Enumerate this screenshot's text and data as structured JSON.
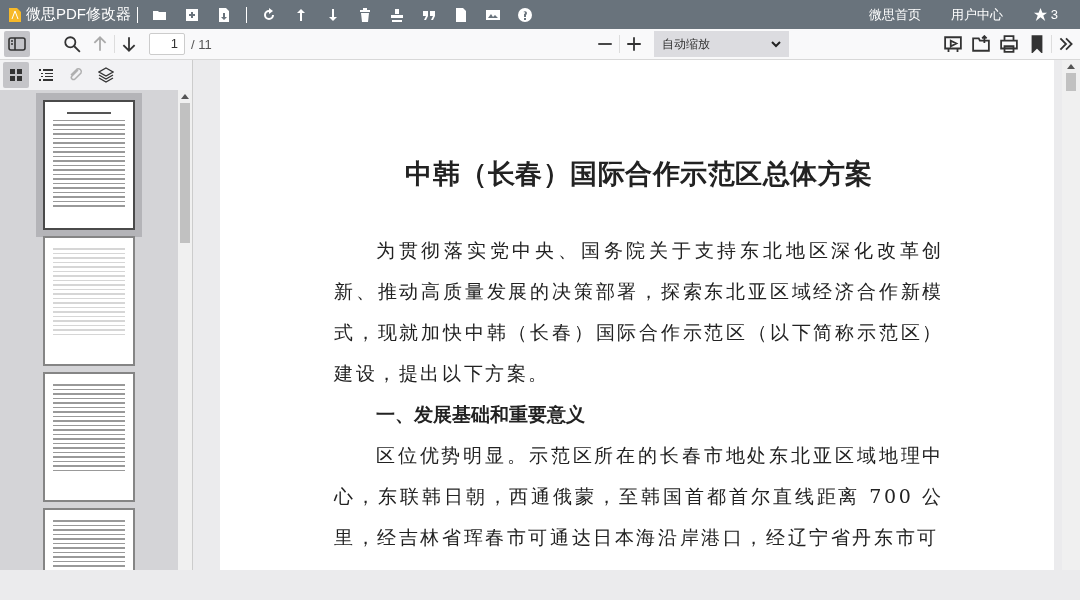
{
  "app": {
    "title": "微思PDF修改器",
    "links": [
      {
        "label": "微思首页"
      },
      {
        "label": "用户中心"
      }
    ],
    "star_count": "3"
  },
  "toolbar": {
    "sidebar_open": true,
    "nav_buttons": [
      {
        "kind": "previous",
        "disabled": true
      },
      {
        "kind": "next",
        "disabled": false
      }
    ],
    "page_input": "1",
    "page_count": "/ 11",
    "zoom": "自动缩放"
  },
  "sidebar": {
    "tabs": [
      {
        "kind": "thumbnails",
        "selected": true,
        "disabled": false
      },
      {
        "kind": "outline",
        "selected": false,
        "disabled": false
      },
      {
        "kind": "attachments",
        "selected": false,
        "disabled": true
      },
      {
        "kind": "layers",
        "selected": false,
        "disabled": false
      }
    ],
    "thumbnails": [
      {
        "selected": true,
        "kind": "title"
      },
      {
        "selected": false,
        "kind": "faint"
      },
      {
        "selected": false,
        "kind": "dense"
      },
      {
        "selected": false,
        "kind": "dense"
      }
    ]
  },
  "document": {
    "title": "中韩（长春）国际合作示范区总体方案",
    "blocks": [
      {
        "kind": "paragraph",
        "text": "为贯彻落实党中央、国务院关于支持东北地区深化改革创新、推动高质量发展的决策部署，探索东北亚区域经济合作新模式，现就加快中韩（长春）国际合作示范区（以下简称示范区）建设，提出以下方案。"
      },
      {
        "kind": "heading",
        "text": "一、发展基础和重要意义"
      },
      {
        "kind": "paragraph",
        "text": "区位优势明显。示范区所在的长春市地处东北亚区域地理中心，东联韩日朝，西通俄蒙，至韩国首都首尔直线距离 700 公里，经吉林省珲春市可通达日本海沿岸港口，经辽宁省丹东市可"
      }
    ]
  }
}
